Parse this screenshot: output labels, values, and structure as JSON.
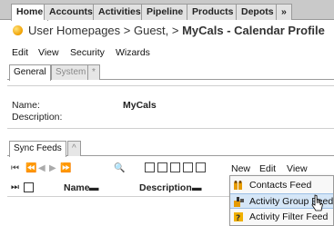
{
  "tabs": [
    {
      "label": "Home",
      "active": true
    },
    {
      "label": "Accounts"
    },
    {
      "label": "Activities"
    },
    {
      "label": "Pipeline"
    },
    {
      "label": "Products"
    },
    {
      "label": "Depots"
    },
    {
      "label": "»"
    }
  ],
  "breadcrumb": {
    "prefix": "User Homepages > Guest, > ",
    "current": "MyCals - Calendar Profile"
  },
  "menu": {
    "edit": "Edit",
    "view": "View",
    "security": "Security",
    "wizards": "Wizards"
  },
  "subtabs": {
    "general": "General",
    "system": "System",
    "more": "*"
  },
  "profile": {
    "name_label": "Name:",
    "name_value": "MyCals",
    "description_label": "Description:"
  },
  "panel": {
    "tab_label": "Sync Feeds",
    "tab_more": "^"
  },
  "toolbar": {
    "new": "New",
    "edit": "Edit",
    "view": "View"
  },
  "grid": {
    "columns": [
      "Name",
      "Description"
    ],
    "sort_marker": "▬"
  },
  "dropdown": {
    "items": [
      {
        "label": "Contacts Feed"
      },
      {
        "label": "Activity Group Feed",
        "highlighted": true
      },
      {
        "label": "Activity Filter Feed"
      }
    ]
  },
  "colors": {
    "tabbar": "#c9c9c9",
    "highlight": "#d5e6f7",
    "accent": "#f0a000"
  }
}
